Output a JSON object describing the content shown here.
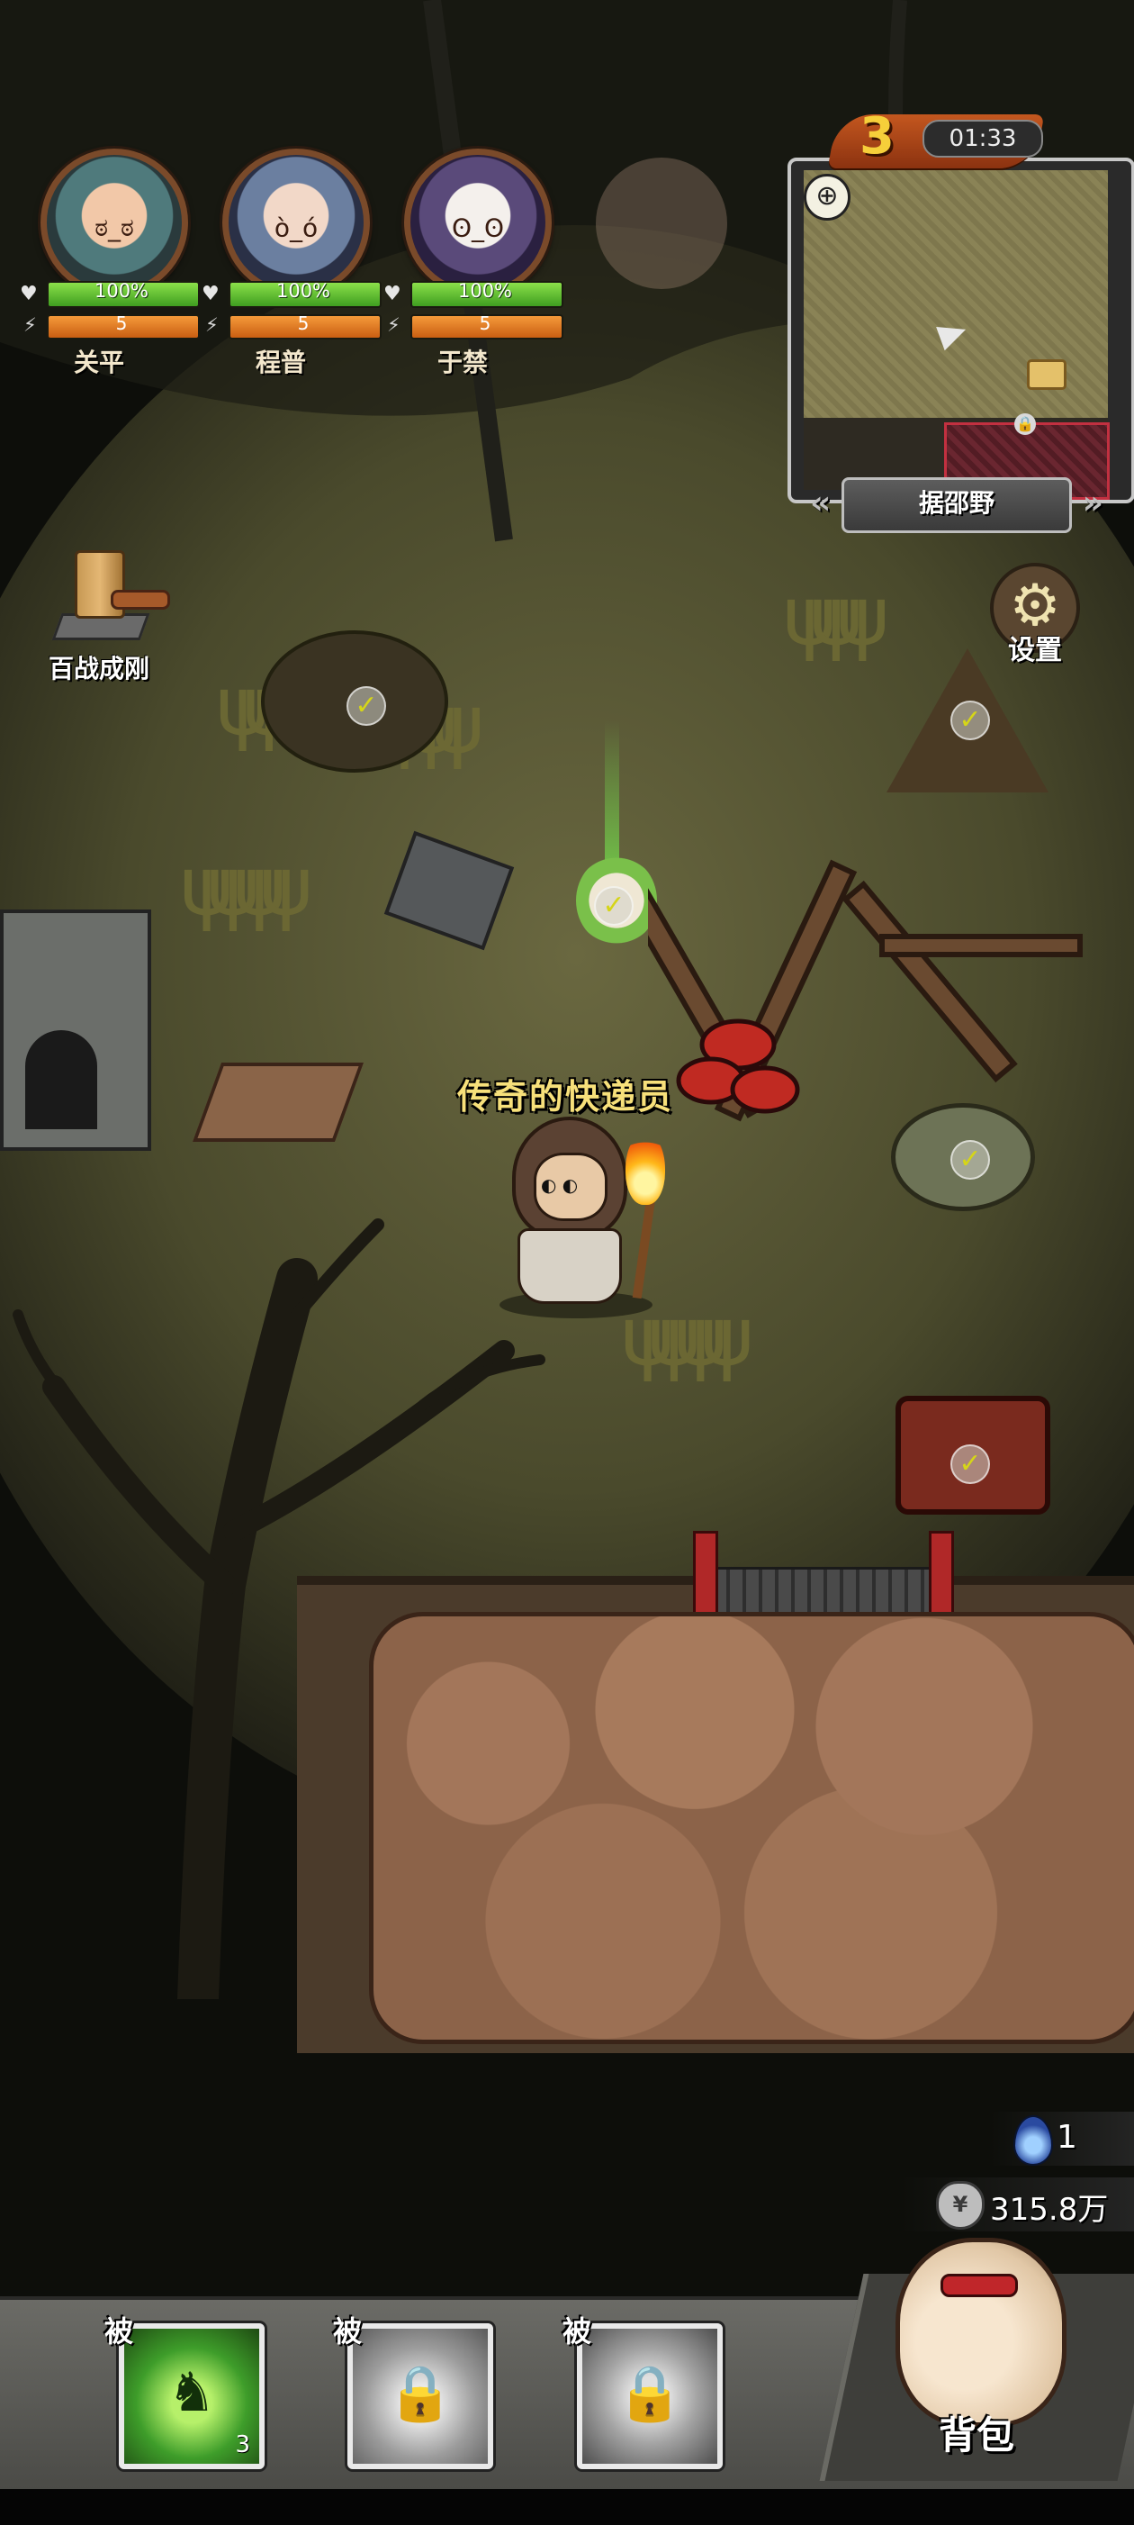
{
  "party": [
    {
      "name": "关平",
      "hp_text": "100%",
      "hp_fraction": 1.0,
      "energy_text": "5",
      "energy_fraction": 1.0
    },
    {
      "name": "程普",
      "hp_text": "100%",
      "hp_fraction": 1.0,
      "energy_text": "5",
      "energy_fraction": 1.0
    },
    {
      "name": "于禁",
      "hp_text": "100%",
      "hp_fraction": 1.0,
      "energy_text": "5",
      "energy_fraction": 1.0
    }
  ],
  "minimap": {
    "level": "3",
    "timer": "01:33",
    "area_name": "据邵野"
  },
  "settings": {
    "label": "设置"
  },
  "tool": {
    "label": "百战成刚"
  },
  "npc": {
    "label": "传奇的快递员"
  },
  "currency": {
    "gem": "1",
    "coins": "315.8万"
  },
  "skills": [
    {
      "tag": "被",
      "count": "3",
      "state": "unlocked"
    },
    {
      "tag": "被",
      "count": "",
      "state": "locked"
    },
    {
      "tag": "被",
      "count": "",
      "state": "locked"
    }
  ],
  "backpack": {
    "label": "背包"
  },
  "colors": {
    "hp": "#5cc531",
    "energy": "#e9802a",
    "title_text": "#f7e07a",
    "lock_frame": "#c23040"
  }
}
